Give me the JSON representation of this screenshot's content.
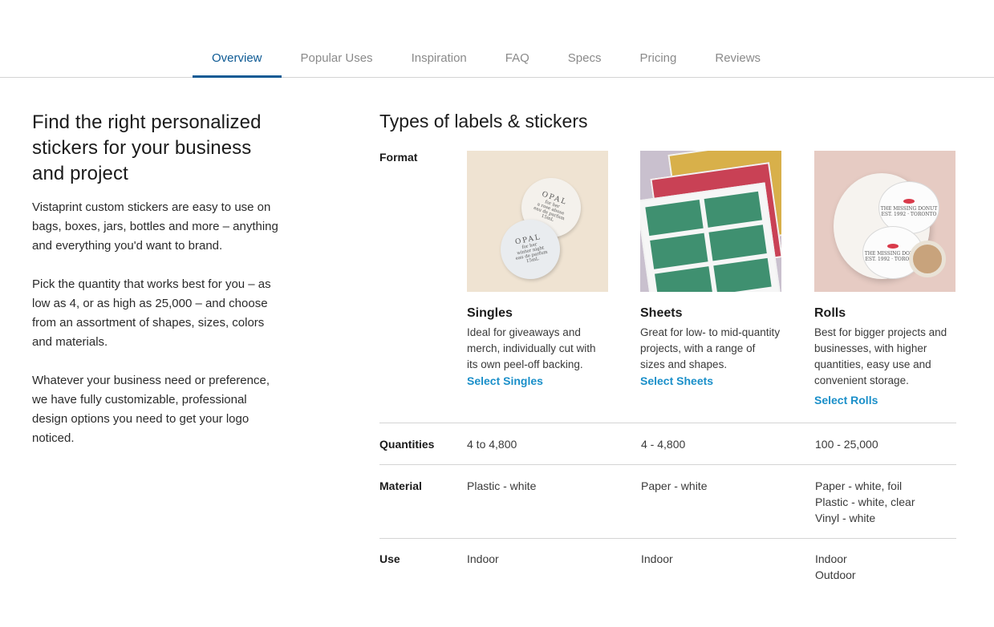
{
  "tabs": [
    {
      "label": "Overview",
      "active": true
    },
    {
      "label": "Popular Uses"
    },
    {
      "label": "Inspiration"
    },
    {
      "label": "FAQ"
    },
    {
      "label": "Specs"
    },
    {
      "label": "Pricing"
    },
    {
      "label": "Reviews"
    }
  ],
  "intro": {
    "heading": "Find the right personalized stickers for your business and project",
    "paragraphs": [
      "Vistaprint custom stickers are easy to use on bags, boxes, jars, bottles and more – anything and everything you'd want to brand.",
      "Pick the quantity that works best for you – as low as 4, or as high as 25,000 – and choose from an assortment of shapes, sizes, colors and materials.",
      "Whatever your business need or preference, we have fully customizable, professional design options you need to get your logo noticed."
    ]
  },
  "types": {
    "heading": "Types of labels & stickers",
    "row_labels": {
      "format": "Format",
      "quantities": "Quantities",
      "material": "Material",
      "use": "Use"
    },
    "products": [
      {
        "name": "Singles",
        "description": "Ideal for giveaways and merch, individually cut with its own peel-off backing.",
        "link": "Select Singles",
        "quantities": "4 to 4,800",
        "material": [
          "Plastic - white"
        ],
        "use": [
          "Indoor"
        ],
        "image_text": {
          "brand": "OPAL",
          "sub": "for her",
          "l1": "a rose abuse",
          "l1sub": "eau de parfum",
          "l2": "winter night",
          "l2sub": "eau de parfum",
          "size": "15mL"
        }
      },
      {
        "name": "Sheets",
        "description": "Great for low- to mid-quantity projects, with a range of sizes and shapes.",
        "link": "Select Sheets",
        "quantities": "4 - 4,800",
        "material": [
          "Paper - white"
        ],
        "use": [
          "Indoor"
        ]
      },
      {
        "name": "Rolls",
        "description": "Best for bigger projects and businesses, with higher quantities, easy use and convenient storage.",
        "link": "Select Rolls",
        "quantities": "100 - 25,000",
        "material": [
          "Paper - white, foil",
          "Plastic - white, clear",
          "Vinyl - white"
        ],
        "use": [
          "Indoor",
          "Outdoor"
        ],
        "image_text": {
          "brand": "THE MISSING DONUT",
          "sub": "EST. 1992 · TORONTO"
        }
      }
    ]
  },
  "colors": {
    "accent": "#0d5a94",
    "link": "#1a8fc9",
    "divider": "#d4d4d4"
  }
}
